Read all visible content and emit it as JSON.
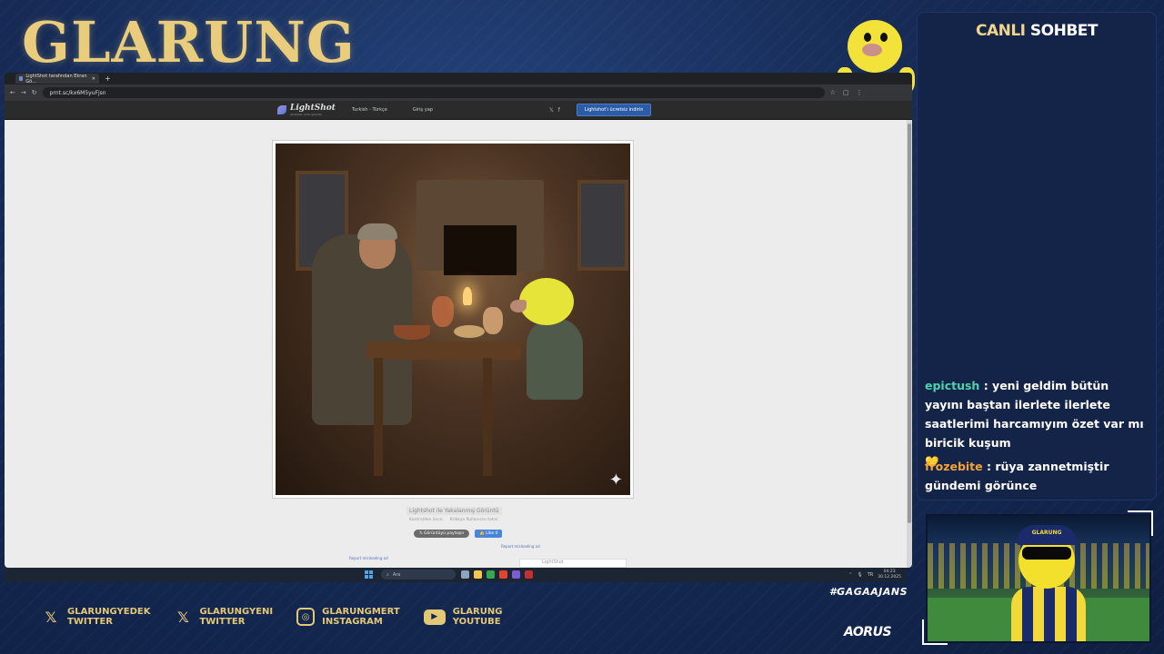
{
  "stream": {
    "logo": "GLARUNG",
    "hashtag": "#GAGAAJANS",
    "sponsor": "AORUS"
  },
  "chat": {
    "title_part1": "CANLI",
    "title_part2": "SOHBET",
    "messages": [
      {
        "user": "epictush",
        "text": " : yeni geldim bütün yayını baştan ilerlete ilerlete saatlerimi harcamıyım özet var mı biricik kuşum",
        "emoji": "💛"
      },
      {
        "user": "frozebite",
        "text": " : rüya zannetmiştir gündemi görünce"
      }
    ]
  },
  "socials": [
    {
      "icon": "x-icon",
      "glyph": "𝕏",
      "name": "GLARUNGYEDEK",
      "platform": "TWITTER"
    },
    {
      "icon": "x-icon",
      "glyph": "𝕏",
      "name": "GLARUNGYENI",
      "platform": "TWITTER"
    },
    {
      "icon": "instagram-icon",
      "glyph": "◎",
      "name": "GLARUNGMERT",
      "platform": "INSTAGRAM"
    },
    {
      "icon": "youtube-icon",
      "glyph": "▶",
      "name": "GLARUNG",
      "platform": "YOUTUBE"
    }
  ],
  "browser": {
    "tab_title": "LightShot tarafından Ekran Gö...",
    "url": "prnt.sc/kx6M5yuFjsn",
    "lightshot": {
      "name": "LightShot",
      "tagline": "ekrandan anlık görüntü",
      "language": "Turkish - Türkçe",
      "login": "Giriş yap",
      "download": "Lightshot'ı ücretsiz indirin"
    },
    "caption": {
      "title": "Lightshot ile Yakalanmış Görüntü",
      "meta1": "Kontrolden önce",
      "meta2": "Krikkya Kullanıcısı tahsi",
      "btn_tweet": "𝕏 Görüntüyü paylaşın",
      "btn_like": "👍 Like 0",
      "report": "Report misleading ad"
    },
    "ad_text": "LightShot"
  },
  "taskbar": {
    "search": "Ara",
    "time": "04:23",
    "date": "30.12.2025",
    "lang": "TR"
  },
  "colors": {
    "gold": "#e9cc7c",
    "chat_user1": "#4ed3ad",
    "chat_user2": "#f2a33a",
    "bg": "#14254a"
  }
}
